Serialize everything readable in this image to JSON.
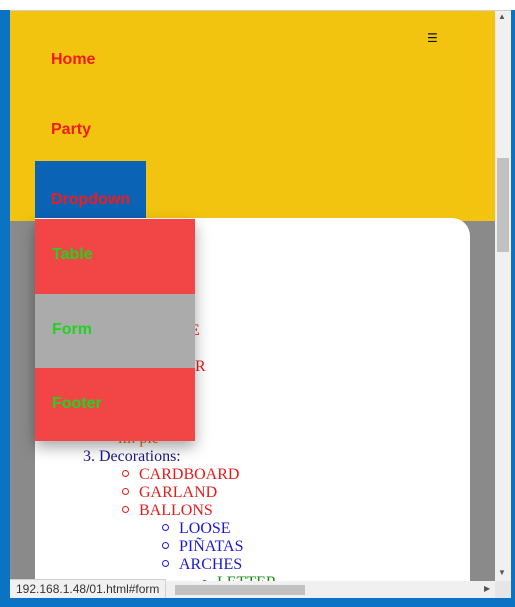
{
  "navbar": {
    "items": [
      "Home",
      "Party",
      "Dropdown"
    ],
    "menu_icon": "☰"
  },
  "dropdown": {
    "items": [
      "Table",
      "Form",
      "Footer"
    ]
  },
  "content": {
    "partial_e": "E",
    "partial_r": "R",
    "pie_line": "iii. pie",
    "decorations_label": "3. Decorations:",
    "decorations": [
      "CARDBOARD",
      "GARLAND",
      "BALLONS"
    ],
    "ballons_sub": [
      "LOOSE",
      "PIÑATAS",
      "ARCHES"
    ],
    "arches_sub": [
      "LETTER"
    ]
  },
  "status_bar": {
    "url": "192.168.1.48/01.html#form"
  },
  "colors": {
    "navbar_bg": "#f2c40f",
    "nav_text": "#f21b1b",
    "dropdown_active_bg": "#0b63b5",
    "menu_item_bg": "#f24646",
    "menu_item_hover_bg": "#ababab",
    "menu_item_text": "#1fd41f"
  }
}
